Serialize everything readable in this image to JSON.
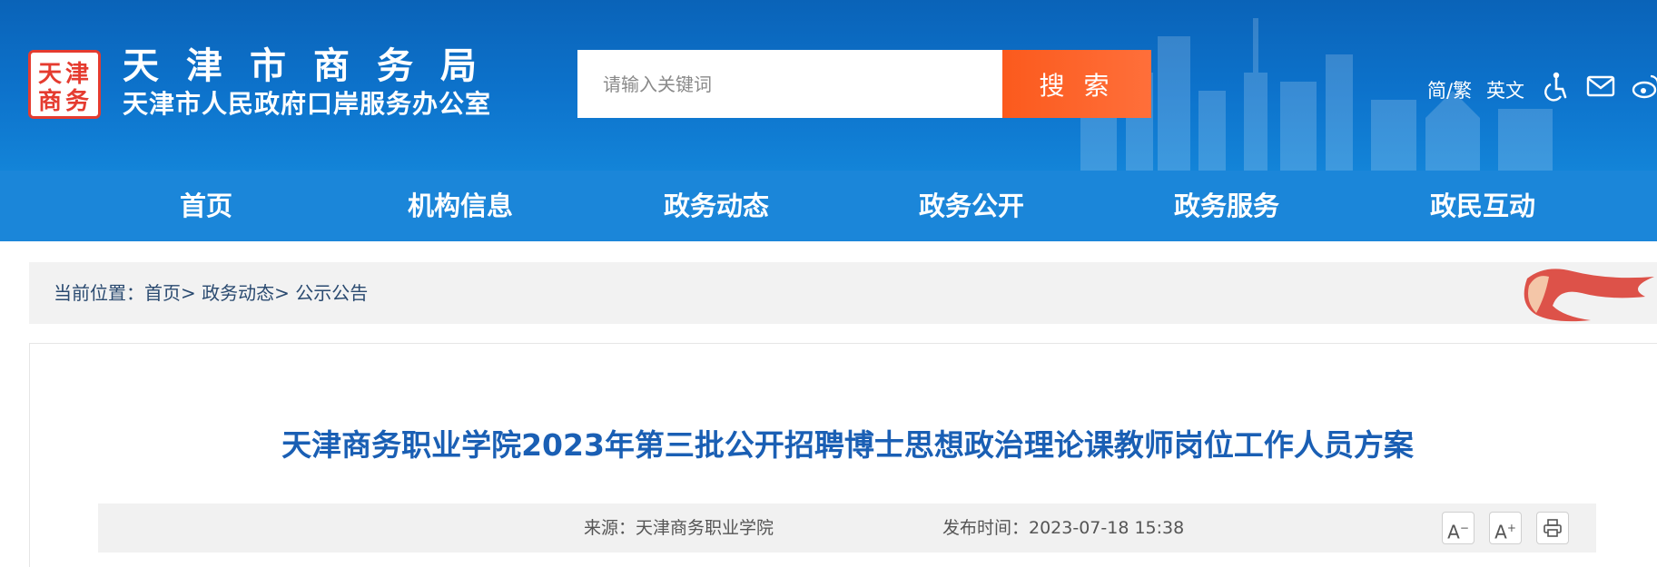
{
  "header": {
    "logo_text": "天津 商务",
    "title": "天津市商务局",
    "subtitle": "天津市人民政府口岸服务办公室",
    "search": {
      "placeholder": "请输入关键词",
      "button_label": "搜 索"
    },
    "links": {
      "simplified_traditional": "简/繁",
      "english": "英文"
    },
    "icons": [
      "accessibility-icon",
      "mail-icon",
      "weibo-icon"
    ]
  },
  "nav": {
    "items": [
      {
        "label": "首页"
      },
      {
        "label": "机构信息"
      },
      {
        "label": "政务动态"
      },
      {
        "label": "政务公开"
      },
      {
        "label": "政务服务"
      },
      {
        "label": "政民互动"
      }
    ]
  },
  "breadcrumb": {
    "prefix": "当前位置：",
    "items": [
      "首页",
      "政务动态",
      "公示公告"
    ],
    "separator": ">"
  },
  "article": {
    "title": "天津商务职业学院2023年第三批公开招聘博士思想政治理论课教师岗位工作人员方案",
    "source": "来源：天津商务职业学院",
    "published": "发布时间：2023-07-18 15:38",
    "tools": {
      "font_decrease": "A",
      "font_increase": "A"
    }
  },
  "colors": {
    "header_blue": "#0d73cc",
    "nav_blue": "#1b86d9",
    "search_orange": "#fb5a1d",
    "title_blue": "#1a5fb4",
    "logo_red": "#e53b2f"
  }
}
